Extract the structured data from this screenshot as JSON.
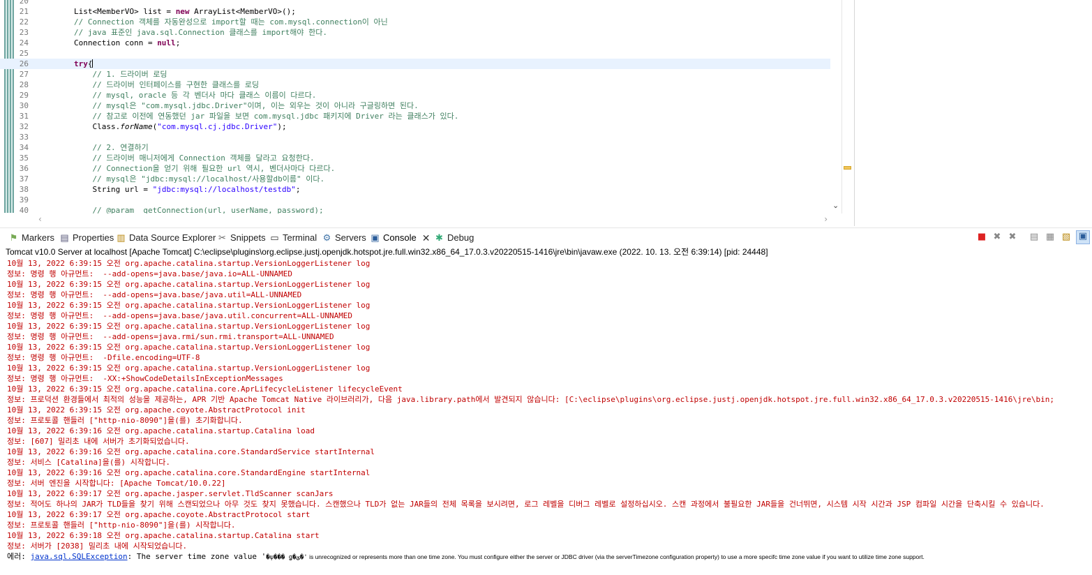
{
  "editor": {
    "lines": [
      {
        "n": "20",
        "t": ""
      },
      {
        "n": "21",
        "t": "        List<MemberVO> list = new ArrayList<MemberVO>();"
      },
      {
        "n": "22",
        "t": "        // Connection 객체를 자동완성으로 import할 때는 com.mysql.connection이 아닌"
      },
      {
        "n": "23",
        "t": "        // java 표준인 java.sql.Connection 클래스를 import해야 한다."
      },
      {
        "n": "24",
        "t": "        Connection conn = null;"
      },
      {
        "n": "25",
        "t": ""
      },
      {
        "n": "26",
        "t": "        try{"
      },
      {
        "n": "27",
        "t": "            // 1. 드라이버 로딩"
      },
      {
        "n": "28",
        "t": "            // 드라이버 인터페이스를 구현한 클래스를 로딩"
      },
      {
        "n": "29",
        "t": "            // mysql, oracle 등 각 벤더사 마다 클래스 이름이 다르다."
      },
      {
        "n": "30",
        "t": "            // mysql은 \"com.mysql.jdbc.Driver\"이며, 이는 외우는 것이 아니라 구글링하면 된다."
      },
      {
        "n": "31",
        "t": "            // 참고로 이전에 연동했던 jar 파일을 보면 com.mysql.jdbc 패키지에 Driver 라는 클래스가 있다."
      },
      {
        "n": "32",
        "t": "            Class.forName(\"com.mysql.cj.jdbc.Driver\");"
      },
      {
        "n": "33",
        "t": ""
      },
      {
        "n": "34",
        "t": "            // 2. 연결하기"
      },
      {
        "n": "35",
        "t": "            // 드라이버 매니저에게 Connection 객체를 달라고 요청한다."
      },
      {
        "n": "36",
        "t": "            // Connection을 얻기 위해 필요한 url 역시, 벤더사마다 다르다."
      },
      {
        "n": "37",
        "t": "            // mysql은 \"jdbc:mysql://localhost/사용할db이름\" 이다."
      },
      {
        "n": "38",
        "t": "            String url = \"jdbc:mysql://localhost/testdb\";"
      },
      {
        "n": "39",
        "t": ""
      },
      {
        "n": "40",
        "t": "            // @param  getConnection(url, userName, password);"
      }
    ],
    "current_line": "26"
  },
  "views": {
    "tabs": [
      {
        "id": "markers",
        "label": "Markers",
        "icon": "markers-icon"
      },
      {
        "id": "properties",
        "label": "Properties",
        "icon": "properties-icon"
      },
      {
        "id": "data-source-explorer",
        "label": "Data Source Explorer",
        "icon": "data-source-icon"
      },
      {
        "id": "snippets",
        "label": "Snippets",
        "icon": "snippets-icon"
      },
      {
        "id": "terminal",
        "label": "Terminal",
        "icon": "terminal-icon"
      },
      {
        "id": "servers",
        "label": "Servers",
        "icon": "servers-icon"
      },
      {
        "id": "console",
        "label": "Console",
        "icon": "console-icon",
        "active": true
      },
      {
        "id": "debug",
        "label": "Debug",
        "icon": "debug-icon"
      }
    ],
    "close_glyph": "✕"
  },
  "console": {
    "header": "Tomcat v10.0 Server at localhost [Apache Tomcat] C:\\eclipse\\plugins\\org.eclipse.justj.openjdk.hotspot.jre.full.win32.x86_64_17.0.3.v20220515-1416\\jre\\bin\\javaw.exe  (2022. 10. 13. 오전 6:39:14) [pid: 24448]",
    "lines": [
      "10월 13, 2022 6:39:15 오전 org.apache.catalina.startup.VersionLoggerListener log",
      "정보: 명령 행 아규먼트:  --add-opens=java.base/java.io=ALL-UNNAMED",
      "10월 13, 2022 6:39:15 오전 org.apache.catalina.startup.VersionLoggerListener log",
      "정보: 명령 행 아규먼트:  --add-opens=java.base/java.util=ALL-UNNAMED",
      "10월 13, 2022 6:39:15 오전 org.apache.catalina.startup.VersionLoggerListener log",
      "정보: 명령 행 아규먼트:  --add-opens=java.base/java.util.concurrent=ALL-UNNAMED",
      "10월 13, 2022 6:39:15 오전 org.apache.catalina.startup.VersionLoggerListener log",
      "정보: 명령 행 아규먼트:  --add-opens=java.rmi/sun.rmi.transport=ALL-UNNAMED",
      "10월 13, 2022 6:39:15 오전 org.apache.catalina.startup.VersionLoggerListener log",
      "정보: 명령 행 아규먼트:  -Dfile.encoding=UTF-8",
      "10월 13, 2022 6:39:15 오전 org.apache.catalina.startup.VersionLoggerListener log",
      "정보: 명령 행 아규먼트:  -XX:+ShowCodeDetailsInExceptionMessages",
      "10월 13, 2022 6:39:15 오전 org.apache.catalina.core.AprLifecycleListener lifecycleEvent",
      "정보: 프로덕션 환경들에서 최적의 성능을 제공하는, APR 기반 Apache Tomcat Native 라이브러리가, 다음 java.library.path에서 발견되지 않습니다: [C:\\eclipse\\plugins\\org.eclipse.justj.openjdk.hotspot.jre.full.win32.x86_64_17.0.3.v20220515-1416\\jre\\bin;",
      "10월 13, 2022 6:39:15 오전 org.apache.coyote.AbstractProtocol init",
      "정보: 프로토콜 핸들러 [\"http-nio-8090\"]을(를) 초기화합니다.",
      "10월 13, 2022 6:39:16 오전 org.apache.catalina.startup.Catalina load",
      "정보: [607] 밀리초 내에 서버가 초기화되었습니다.",
      "10월 13, 2022 6:39:16 오전 org.apache.catalina.core.StandardService startInternal",
      "정보: 서비스 [Catalina]을(를) 시작합니다.",
      "10월 13, 2022 6:39:16 오전 org.apache.catalina.core.StandardEngine startInternal",
      "정보: 서버 엔진을 시작합니다: [Apache Tomcat/10.0.22]",
      "10월 13, 2022 6:39:17 오전 org.apache.jasper.servlet.TldScanner scanJars",
      "정보: 적어도 하나의 JAR가 TLD들을 찾기 위해 스캔되었으나 아무 것도 찾지 못했습니다. 스캔했으나 TLD가 없는 JAR들의 전체 목록을 보시려면, 로그 레벨을 디버그 레벨로 설정하십시오. 스캔 과정에서 불필요한 JAR들을 건너뛰면, 시스템 시작 시간과 JSP 컴파일 시간을 단축시킬 수 있습니다.",
      "10월 13, 2022 6:39:17 오전 org.apache.coyote.AbstractProtocol start",
      "정보: 프로토콜 핸들러 [\"http-nio-8090\"]을(를) 시작합니다.",
      "10월 13, 2022 6:39:18 오전 org.apache.catalina.startup.Catalina start",
      "정보: 서버가 [2038] 밀리초 내에 시작되었습니다."
    ],
    "error": {
      "prefix": "에러: ",
      "exception": "java.sql.SQLException",
      "mid": ": The server time zone value '",
      "garbled": "�ѱ��� ǥ�ؽ�'",
      "rest": " is unrecognized or represents more than one time zone. You must configure either the server or JDBC driver (via the serverTimezone configuration property) to use a more specifc time zone value if you want to utilize time zone support."
    }
  },
  "colors": {
    "log_red": "#c00000",
    "keyword": "#7f0055",
    "comment": "#3f7f5f",
    "string": "#2a00ff",
    "current_line": "#e8f2fe"
  }
}
